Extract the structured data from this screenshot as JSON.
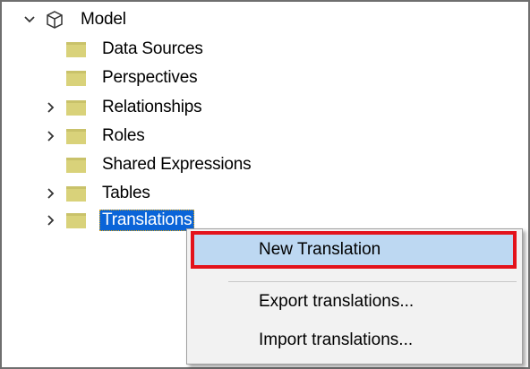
{
  "tree": {
    "root": {
      "label": "Model",
      "icon": "cube-icon",
      "expanded": true
    },
    "items": [
      {
        "label": "Data Sources",
        "expandable": false
      },
      {
        "label": "Perspectives",
        "expandable": false
      },
      {
        "label": "Relationships",
        "expandable": true
      },
      {
        "label": "Roles",
        "expandable": true
      },
      {
        "label": "Shared Expressions",
        "expandable": false
      },
      {
        "label": "Tables",
        "expandable": true
      },
      {
        "label": "Translations",
        "expandable": true,
        "selected": true
      }
    ]
  },
  "context_menu": {
    "items": [
      {
        "label": "New Translation",
        "highlighted": true
      },
      {
        "label": "Export translations..."
      },
      {
        "label": "Import translations..."
      }
    ]
  },
  "colors": {
    "folder": "#d9d27a",
    "selection": "#0a64d8",
    "highlight_border": "#e3121b",
    "menu_hover": "#bdd8f2"
  }
}
